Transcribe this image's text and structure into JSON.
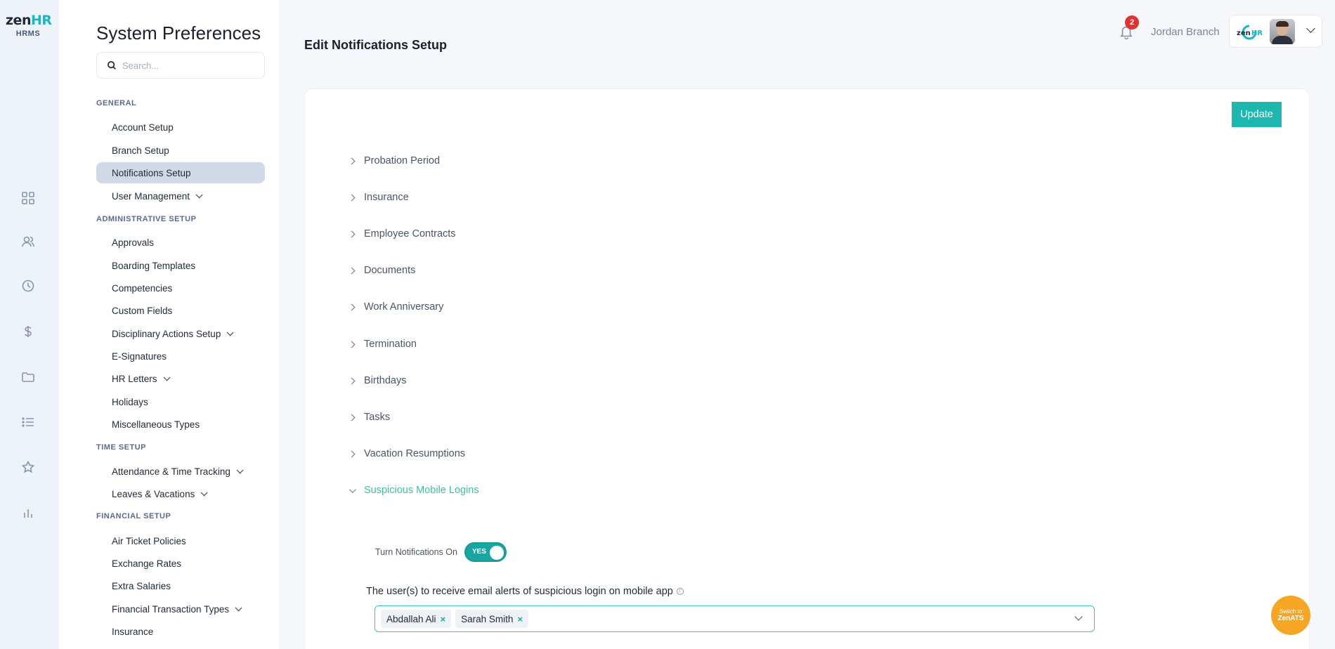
{
  "brand": {
    "logo_zen": "zen",
    "logo_hr": "HR",
    "sub": "HRMS"
  },
  "rail": {
    "icons": [
      "grid-icon",
      "users-icon",
      "clock-icon",
      "dollar-icon",
      "folder-icon",
      "list-icon",
      "star-icon",
      "bar-chart-icon"
    ]
  },
  "prefs": {
    "title": "System Preferences",
    "search_placeholder": "Search...",
    "sections": {
      "general": "GENERAL",
      "administrative": "ADMINISTRATIVE SETUP",
      "time": "TIME SETUP",
      "financial": "FINANCIAL SETUP"
    },
    "items": {
      "account_setup": "Account Setup",
      "branch_setup": "Branch Setup",
      "notifications_setup": "Notifications Setup",
      "user_management": "User Management",
      "approvals": "Approvals",
      "boarding_templates": "Boarding Templates",
      "competencies": "Competencies",
      "custom_fields": "Custom Fields",
      "disciplinary_actions": "Disciplinary Actions Setup",
      "e_signatures": "E-Signatures",
      "hr_letters": "HR Letters",
      "holidays": "Holidays",
      "misc_types": "Miscellaneous Types",
      "attendance": "Attendance & Time Tracking",
      "leaves": "Leaves & Vacations",
      "air_ticket": "Air Ticket Policies",
      "exchange_rates": "Exchange Rates",
      "extra_salaries": "Extra Salaries",
      "financial_transaction_types": "Financial Transaction Types",
      "insurance": "Insurance"
    }
  },
  "header": {
    "page_title": "Edit Notifications Setup",
    "notif_count": "2",
    "user_name": "Jordan Branch"
  },
  "main": {
    "update_label": "Update",
    "accordions": {
      "probation": "Probation Period",
      "insurance": "Insurance",
      "contracts": "Employee Contracts",
      "documents": "Documents",
      "anniversary": "Work Anniversary",
      "termination": "Termination",
      "birthdays": "Birthdays",
      "tasks": "Tasks",
      "vacation": "Vacation Resumptions",
      "suspicious": "Suspicious Mobile Logins"
    },
    "toggle_label": "Turn Notifications On",
    "toggle_value": "YES",
    "recipients_label": "The user(s) to receive email alerts of suspicious login on mobile app",
    "info_glyph": "i",
    "chips": [
      "Abdallah Ali",
      "Sarah Smith"
    ],
    "chip_remove": "×"
  },
  "switch_ats": {
    "line1": "Switch to",
    "line2": "ZenATS"
  },
  "colors": {
    "accent": "#1db7b0",
    "open_section": "#3bbf9f",
    "badge": "#e5322d",
    "ats_button": "#f7a624"
  }
}
